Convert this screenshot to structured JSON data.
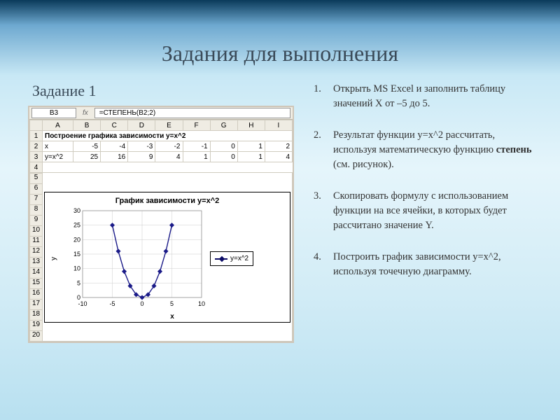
{
  "title": "Задания для выполнения",
  "subtitle": "Задание 1",
  "instructions": [
    {
      "lead": "Открыть MS Excel и заполнить таблицу значений X от –5 до 5."
    },
    {
      "lead": "Результат функции y=x^2 рассчитать, используя математическую функцию ",
      "bold": "степень",
      "tail": " (см. рисунок)."
    },
    {
      "lead": "Скопировать формулу с использованием функции на все ячейки, в которых будет рассчитано значение Y."
    },
    {
      "lead": "Построить график зависимости y=x^2, используя точечную диаграмму."
    }
  ],
  "excel": {
    "name_box": "B3",
    "fx_label": "fx",
    "formula": "=СТЕПЕНЬ(B2;2)",
    "columns": [
      "",
      "A",
      "B",
      "C",
      "D",
      "E",
      "F",
      "G",
      "H",
      "I"
    ],
    "row1_label": "Построение графика зависимости y=x^2",
    "row2": {
      "label": "x",
      "vals": [
        "-5",
        "-4",
        "-3",
        "-2",
        "-1",
        "0",
        "1",
        "2"
      ]
    },
    "row3": {
      "label": "y=x^2",
      "vals": [
        "25",
        "16",
        "9",
        "4",
        "1",
        "0",
        "1",
        "4"
      ]
    },
    "extra_row_nums": [
      "4",
      "5",
      "6",
      "7",
      "8",
      "9",
      "10",
      "11",
      "12",
      "13",
      "14",
      "15",
      "16",
      "17",
      "18",
      "19",
      "20"
    ]
  },
  "chart_data": {
    "type": "scatter",
    "title": "График зависимости y=x^2",
    "xlabel": "x",
    "ylabel": "y",
    "xlim": [
      -10,
      10
    ],
    "ylim": [
      0,
      30
    ],
    "xticks": [
      -10,
      -5,
      0,
      5,
      10
    ],
    "yticks": [
      0,
      5,
      10,
      15,
      20,
      25,
      30
    ],
    "series": [
      {
        "name": "y=x^2",
        "x": [
          -5,
          -4,
          -3,
          -2,
          -1,
          0,
          1,
          2,
          3,
          4,
          5
        ],
        "y": [
          25,
          16,
          9,
          4,
          1,
          0,
          1,
          4,
          9,
          16,
          25
        ]
      }
    ]
  }
}
